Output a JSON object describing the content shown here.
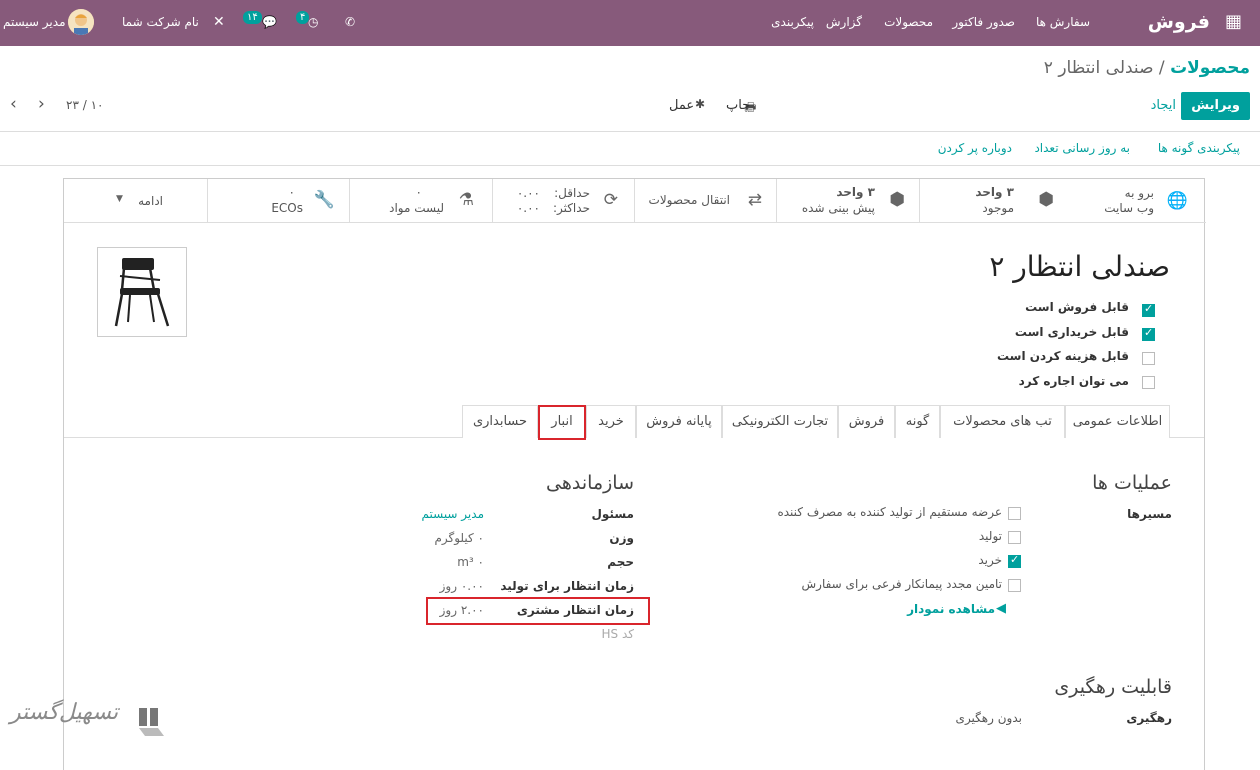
{
  "navbar": {
    "brand": "فروش",
    "menu": [
      "سفارش ها",
      "صدور فاکتور",
      "محصولات",
      "گزارش",
      "پیکربندی"
    ],
    "company": "نام شرکت شما",
    "user": "مدیر سیستم",
    "badge_messages": "۱۴",
    "badge_activities": "۴",
    "bg_color": "#875a7b"
  },
  "breadcrumb": {
    "parent": "محصولات",
    "sep": " / ",
    "current": "صندلی انتظار ۲"
  },
  "controls": {
    "edit": "ویرایش",
    "create": "ایجاد",
    "print": "چاپ",
    "action": "عمل",
    "pager": "۱۰ / ۲۳"
  },
  "header_buttons": [
    "پیکربندی گونه ها",
    "به روز رسانی تعداد",
    "دوباره پر کردن"
  ],
  "smart_buttons": {
    "website_line1": "برو به",
    "website_line2": "وب سایت",
    "onhand_line1": "۳ واحد",
    "onhand_line2": "موجود",
    "forecast_line1": "۳ واحد",
    "forecast_line2": "پیش بینی شده",
    "moves": "انتقال محصولات",
    "min_label": "حداقل:",
    "min_value": "۰.۰۰",
    "max_label": "حداکثر:",
    "max_value": "۰.۰۰",
    "bom_count": "۰",
    "bom_label": "لیست مواد",
    "eco_count": "۰",
    "eco_label": "ECOs",
    "more": "ادامه"
  },
  "product": {
    "name": "صندلی انتظار ۲",
    "flags": [
      {
        "label": "قابل فروش است",
        "checked": true
      },
      {
        "label": "قابل خریداری است",
        "checked": true
      },
      {
        "label": "قابل هزینه کردن است",
        "checked": false
      },
      {
        "label": "می توان اجاره کرد",
        "checked": false
      }
    ]
  },
  "tabs": [
    "اطلاعات عمومی",
    "تب های محصولات",
    "گونه",
    "فروش",
    "تجارت الکترونیکی",
    "پایانه فروش",
    "خرید",
    "انبار",
    "حسابداری"
  ],
  "operations": {
    "title": "عملیات ها",
    "routes_label": "مسیرها",
    "routes": [
      {
        "label": "عرضه مستقیم از تولید کننده به مصرف کننده",
        "checked": false
      },
      {
        "label": "تولید",
        "checked": false
      },
      {
        "label": "خرید",
        "checked": true
      },
      {
        "label": "تامین مجدد پیمانکار فرعی برای سفارش",
        "checked": false
      }
    ],
    "diagram_link": "مشاهده نمودار"
  },
  "logistics": {
    "title": "سازماندهی",
    "responsible_label": "مسئول",
    "responsible_value": "مدیر سیستم",
    "weight_label": "وزن",
    "weight_value": "۰ کیلوگرم",
    "volume_label": "حجم",
    "volume_value": "m³ ۰",
    "mfg_lead_label": "زمان انتظار برای تولید",
    "mfg_lead_value": "۰.۰۰ روز",
    "cust_lead_label": "زمان انتظار مشتری",
    "cust_lead_value": "۲.۰۰ روز",
    "hs_label": "کد HS"
  },
  "traceability": {
    "title": "قابلیت رهگیری",
    "label": "رهگیری",
    "value": "بدون رهگیری"
  },
  "watermark": "تسهیل‌گستر"
}
